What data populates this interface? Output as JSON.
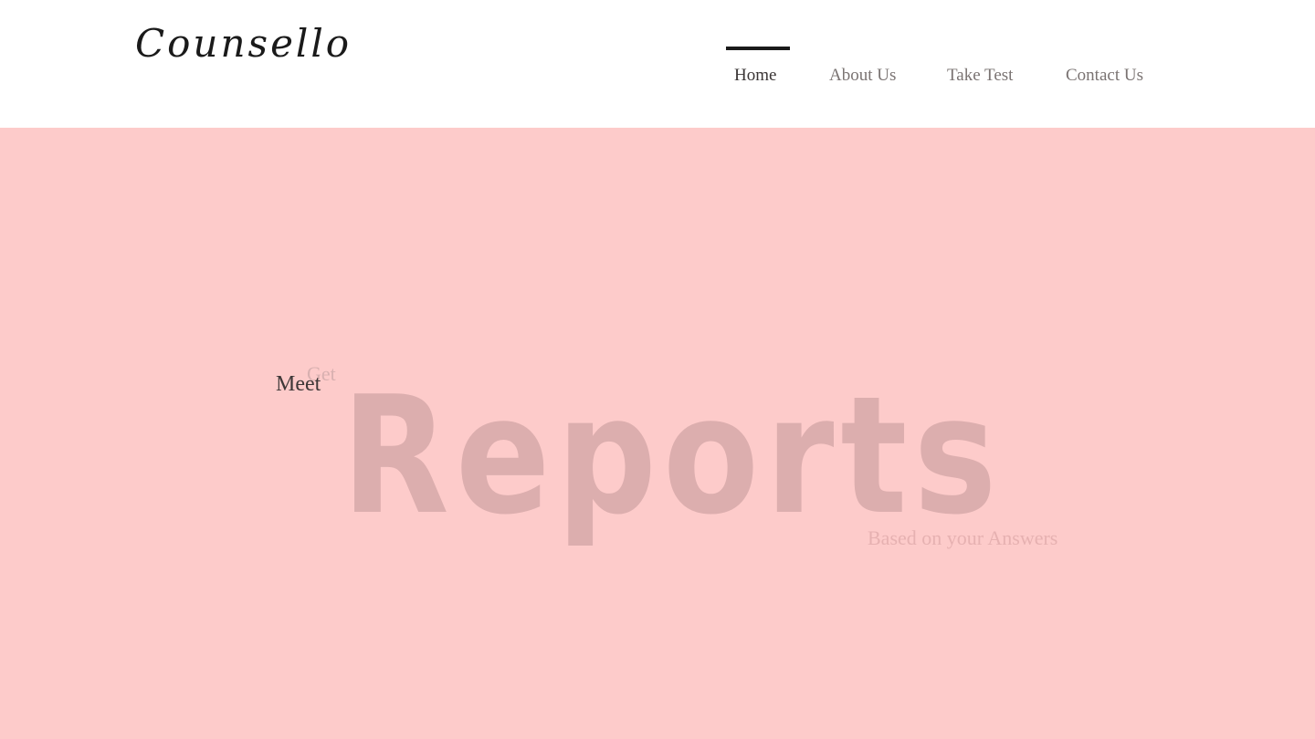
{
  "brand": {
    "logo_text": "Counsello"
  },
  "nav": {
    "items": [
      {
        "label": "Home",
        "active": true
      },
      {
        "label": "About Us",
        "active": false
      },
      {
        "label": "Take Test",
        "active": false
      },
      {
        "label": "Contact Us",
        "active": false
      }
    ]
  },
  "hero": {
    "line_meet": "Meet",
    "line_get": "Get",
    "headline": "Reports",
    "subline": "Based on your Answers",
    "background_color": "#fdcbca"
  }
}
